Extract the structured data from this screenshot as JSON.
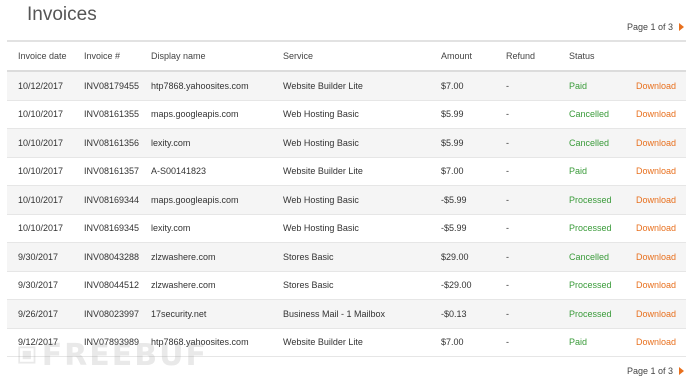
{
  "page_title": "Invoices",
  "pagination": {
    "label": "Page 1 of 3"
  },
  "columns": [
    "Invoice date",
    "Invoice #",
    "Display name",
    "Service",
    "Amount",
    "Refund",
    "Status",
    ""
  ],
  "rows": [
    {
      "date": "10/12/2017",
      "invoice": "INV08179455",
      "name": "htp7868.yahoosites.com",
      "service": "Website Builder Lite",
      "amount": "$7.00",
      "refund": "-",
      "status": "Paid",
      "action": "Download"
    },
    {
      "date": "10/10/2017",
      "invoice": "INV08161355",
      "name": "maps.googleapis.com",
      "service": "Web Hosting Basic",
      "amount": "$5.99",
      "refund": "-",
      "status": "Cancelled",
      "action": "Download"
    },
    {
      "date": "10/10/2017",
      "invoice": "INV08161356",
      "name": "lexity.com",
      "service": "Web Hosting Basic",
      "amount": "$5.99",
      "refund": "-",
      "status": "Cancelled",
      "action": "Download"
    },
    {
      "date": "10/10/2017",
      "invoice": "INV08161357",
      "name": "A-S00141823",
      "service": "Website Builder Lite",
      "amount": "$7.00",
      "refund": "-",
      "status": "Paid",
      "action": "Download"
    },
    {
      "date": "10/10/2017",
      "invoice": "INV08169344",
      "name": "maps.googleapis.com",
      "service": "Web Hosting Basic",
      "amount": "-$5.99",
      "refund": "-",
      "status": "Processed",
      "action": "Download"
    },
    {
      "date": "10/10/2017",
      "invoice": "INV08169345",
      "name": "lexity.com",
      "service": "Web Hosting Basic",
      "amount": "-$5.99",
      "refund": "-",
      "status": "Processed",
      "action": "Download"
    },
    {
      "date": "9/30/2017",
      "invoice": "INV08043288",
      "name": "zlzwashere.com",
      "service": "Stores Basic",
      "amount": "$29.00",
      "refund": "-",
      "status": "Cancelled",
      "action": "Download"
    },
    {
      "date": "9/30/2017",
      "invoice": "INV08044512",
      "name": "zlzwashere.com",
      "service": "Stores Basic",
      "amount": "-$29.00",
      "refund": "-",
      "status": "Processed",
      "action": "Download"
    },
    {
      "date": "9/26/2017",
      "invoice": "INV08023997",
      "name": "17security.net",
      "service": "Business Mail - 1 Mailbox",
      "amount": "-$0.13",
      "refund": "-",
      "status": "Processed",
      "action": "Download"
    },
    {
      "date": "9/12/2017",
      "invoice": "INV07893989",
      "name": "htp7868.yahoosites.com",
      "service": "Website Builder Lite",
      "amount": "$7.00",
      "refund": "-",
      "status": "Paid",
      "action": "Download"
    }
  ],
  "watermark": "FREEBUF",
  "colors": {
    "accent": "#e8701e",
    "status_green": "#3a9b3a"
  },
  "icons": {
    "next_page": "caret-right-icon"
  }
}
